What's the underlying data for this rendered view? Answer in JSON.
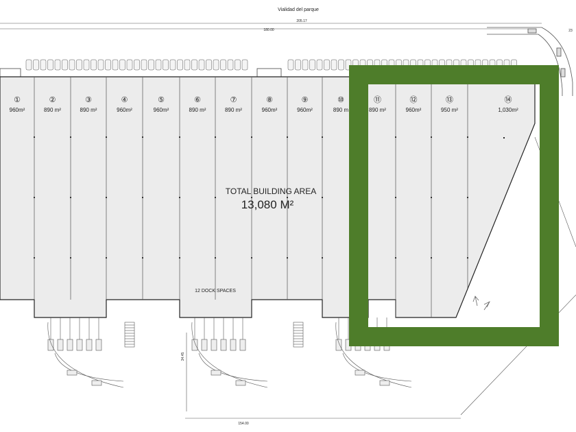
{
  "header": {
    "road_label": "Vialidad del parque",
    "dim_top_outer": "205.17",
    "dim_top_inner": "180.00",
    "dim_top_right": "23",
    "dim_bottom": "154.00",
    "dim_vertical": "34.45"
  },
  "units": [
    {
      "num": "①",
      "area": "960m²"
    },
    {
      "num": "②",
      "area": "890 m²"
    },
    {
      "num": "③",
      "area": "890 m²"
    },
    {
      "num": "④",
      "area": "960m²"
    },
    {
      "num": "⑤",
      "area": "960m²"
    },
    {
      "num": "⑥",
      "area": "890 m²"
    },
    {
      "num": "⑦",
      "area": "890 m²"
    },
    {
      "num": "⑧",
      "area": "960m²"
    },
    {
      "num": "⑨",
      "area": "960m²"
    },
    {
      "num": "⑩",
      "area": "890 m"
    },
    {
      "num": "⑪",
      "area": "890 m²"
    },
    {
      "num": "⑫",
      "area": "960m²"
    },
    {
      "num": "⑬",
      "area": "950 m²"
    },
    {
      "num": "⑭",
      "area": "1,030m²"
    }
  ],
  "summary": {
    "total_label": "TOTAL   BUILDING AREA",
    "total_value": "13,080 M²",
    "dock_label": "12 DOCK SPACES"
  },
  "highlight": {
    "color": "#4e7d2a"
  }
}
